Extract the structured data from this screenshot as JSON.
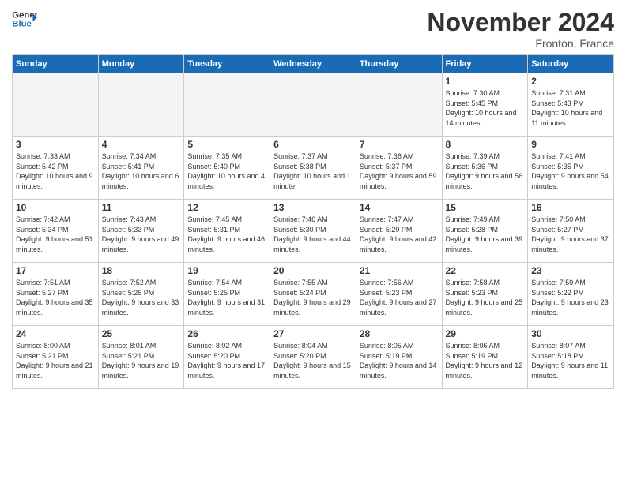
{
  "logo": {
    "line1": "General",
    "line2": "Blue"
  },
  "title": "November 2024",
  "location": "Fronton, France",
  "days_of_week": [
    "Sunday",
    "Monday",
    "Tuesday",
    "Wednesday",
    "Thursday",
    "Friday",
    "Saturday"
  ],
  "weeks": [
    [
      {
        "day": "",
        "info": ""
      },
      {
        "day": "",
        "info": ""
      },
      {
        "day": "",
        "info": ""
      },
      {
        "day": "",
        "info": ""
      },
      {
        "day": "",
        "info": ""
      },
      {
        "day": "1",
        "info": "Sunrise: 7:30 AM\nSunset: 5:45 PM\nDaylight: 10 hours and 14 minutes."
      },
      {
        "day": "2",
        "info": "Sunrise: 7:31 AM\nSunset: 5:43 PM\nDaylight: 10 hours and 11 minutes."
      }
    ],
    [
      {
        "day": "3",
        "info": "Sunrise: 7:33 AM\nSunset: 5:42 PM\nDaylight: 10 hours and 9 minutes."
      },
      {
        "day": "4",
        "info": "Sunrise: 7:34 AM\nSunset: 5:41 PM\nDaylight: 10 hours and 6 minutes."
      },
      {
        "day": "5",
        "info": "Sunrise: 7:35 AM\nSunset: 5:40 PM\nDaylight: 10 hours and 4 minutes."
      },
      {
        "day": "6",
        "info": "Sunrise: 7:37 AM\nSunset: 5:38 PM\nDaylight: 10 hours and 1 minute."
      },
      {
        "day": "7",
        "info": "Sunrise: 7:38 AM\nSunset: 5:37 PM\nDaylight: 9 hours and 59 minutes."
      },
      {
        "day": "8",
        "info": "Sunrise: 7:39 AM\nSunset: 5:36 PM\nDaylight: 9 hours and 56 minutes."
      },
      {
        "day": "9",
        "info": "Sunrise: 7:41 AM\nSunset: 5:35 PM\nDaylight: 9 hours and 54 minutes."
      }
    ],
    [
      {
        "day": "10",
        "info": "Sunrise: 7:42 AM\nSunset: 5:34 PM\nDaylight: 9 hours and 51 minutes."
      },
      {
        "day": "11",
        "info": "Sunrise: 7:43 AM\nSunset: 5:33 PM\nDaylight: 9 hours and 49 minutes."
      },
      {
        "day": "12",
        "info": "Sunrise: 7:45 AM\nSunset: 5:31 PM\nDaylight: 9 hours and 46 minutes."
      },
      {
        "day": "13",
        "info": "Sunrise: 7:46 AM\nSunset: 5:30 PM\nDaylight: 9 hours and 44 minutes."
      },
      {
        "day": "14",
        "info": "Sunrise: 7:47 AM\nSunset: 5:29 PM\nDaylight: 9 hours and 42 minutes."
      },
      {
        "day": "15",
        "info": "Sunrise: 7:49 AM\nSunset: 5:28 PM\nDaylight: 9 hours and 39 minutes."
      },
      {
        "day": "16",
        "info": "Sunrise: 7:50 AM\nSunset: 5:27 PM\nDaylight: 9 hours and 37 minutes."
      }
    ],
    [
      {
        "day": "17",
        "info": "Sunrise: 7:51 AM\nSunset: 5:27 PM\nDaylight: 9 hours and 35 minutes."
      },
      {
        "day": "18",
        "info": "Sunrise: 7:52 AM\nSunset: 5:26 PM\nDaylight: 9 hours and 33 minutes."
      },
      {
        "day": "19",
        "info": "Sunrise: 7:54 AM\nSunset: 5:25 PM\nDaylight: 9 hours and 31 minutes."
      },
      {
        "day": "20",
        "info": "Sunrise: 7:55 AM\nSunset: 5:24 PM\nDaylight: 9 hours and 29 minutes."
      },
      {
        "day": "21",
        "info": "Sunrise: 7:56 AM\nSunset: 5:23 PM\nDaylight: 9 hours and 27 minutes."
      },
      {
        "day": "22",
        "info": "Sunrise: 7:58 AM\nSunset: 5:23 PM\nDaylight: 9 hours and 25 minutes."
      },
      {
        "day": "23",
        "info": "Sunrise: 7:59 AM\nSunset: 5:22 PM\nDaylight: 9 hours and 23 minutes."
      }
    ],
    [
      {
        "day": "24",
        "info": "Sunrise: 8:00 AM\nSunset: 5:21 PM\nDaylight: 9 hours and 21 minutes."
      },
      {
        "day": "25",
        "info": "Sunrise: 8:01 AM\nSunset: 5:21 PM\nDaylight: 9 hours and 19 minutes."
      },
      {
        "day": "26",
        "info": "Sunrise: 8:02 AM\nSunset: 5:20 PM\nDaylight: 9 hours and 17 minutes."
      },
      {
        "day": "27",
        "info": "Sunrise: 8:04 AM\nSunset: 5:20 PM\nDaylight: 9 hours and 15 minutes."
      },
      {
        "day": "28",
        "info": "Sunrise: 8:05 AM\nSunset: 5:19 PM\nDaylight: 9 hours and 14 minutes."
      },
      {
        "day": "29",
        "info": "Sunrise: 8:06 AM\nSunset: 5:19 PM\nDaylight: 9 hours and 12 minutes."
      },
      {
        "day": "30",
        "info": "Sunrise: 8:07 AM\nSunset: 5:18 PM\nDaylight: 9 hours and 11 minutes."
      }
    ]
  ]
}
